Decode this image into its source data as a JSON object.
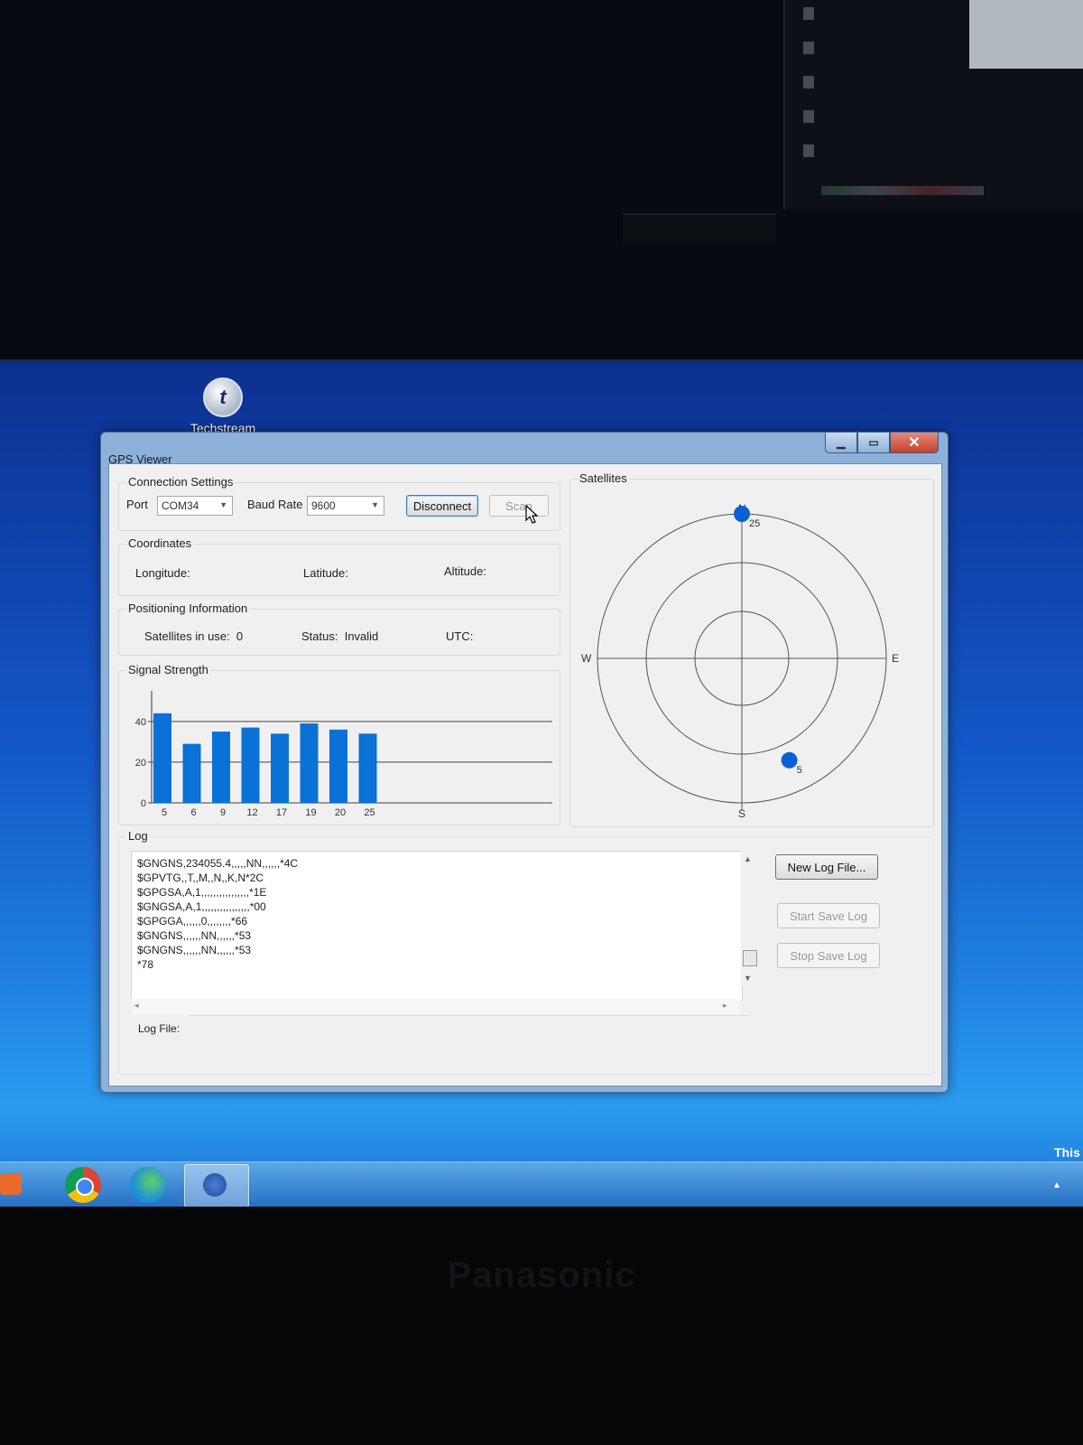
{
  "desktop": {
    "icon_label": "Techstream",
    "icon_glyph": "t"
  },
  "brand": "Panasonic",
  "window": {
    "title": "GPS Viewer",
    "buttons": {
      "minimize": "▁",
      "maximize": "▭",
      "close": "✕"
    }
  },
  "connection": {
    "group_label": "Connection Settings",
    "port_label": "Port",
    "port_value": "COM34",
    "baud_label": "Baud Rate",
    "baud_value": "9600",
    "disconnect_label": "Disconnect",
    "scan_label": "Scan"
  },
  "coordinates": {
    "group_label": "Coordinates",
    "longitude_label": "Longitude:",
    "latitude_label": "Latitude:",
    "altitude_label": "Altitude:"
  },
  "positioning": {
    "group_label": "Positioning Information",
    "sats_label": "Satellites in use:",
    "sats_value": "0",
    "status_label": "Status:",
    "status_value": "Invalid",
    "utc_label": "UTC:"
  },
  "signal": {
    "group_label": "Signal Strength",
    "y_ticks": [
      "0",
      "20",
      "40"
    ]
  },
  "satellites": {
    "group_label": "Satellites",
    "dirs": {
      "n": "N",
      "s": "S",
      "e": "E",
      "w": "W"
    },
    "points": [
      {
        "id": "25",
        "azimuth": 0,
        "elevation": 0
      },
      {
        "id": "5",
        "azimuth": 155,
        "elevation": 20
      }
    ]
  },
  "chart_data": {
    "type": "bar",
    "categories": [
      "5",
      "6",
      "9",
      "12",
      "17",
      "19",
      "20",
      "25"
    ],
    "values": [
      44,
      29,
      35,
      37,
      34,
      39,
      36,
      34
    ],
    "ylim": [
      0,
      55
    ],
    "gridlines": [
      0,
      20,
      40
    ]
  },
  "log": {
    "group_label": "Log",
    "lines": [
      "$GNGNS,234055.4,,,,,NN,,,,,,*4C",
      "$GPVTG,,T,,M,,N,,K,N*2C",
      "$GPGSA,A,1,,,,,,,,,,,,,,,,*1E",
      "$GNGSA,A,1,,,,,,,,,,,,,,,,*00",
      "$GPGGA,,,,,,0,,,,,,,,*66",
      "$GNGNS,,,,,,NN,,,,,,*53",
      "$GNGNS,,,,,,NN,,,,,,*53",
      "*78"
    ],
    "new_log_label": "New Log File...",
    "start_label": "Start Save Log",
    "stop_label": "Stop Save Log",
    "log_file_label": "Log File:"
  },
  "taskbar": {
    "right_text": "This"
  }
}
